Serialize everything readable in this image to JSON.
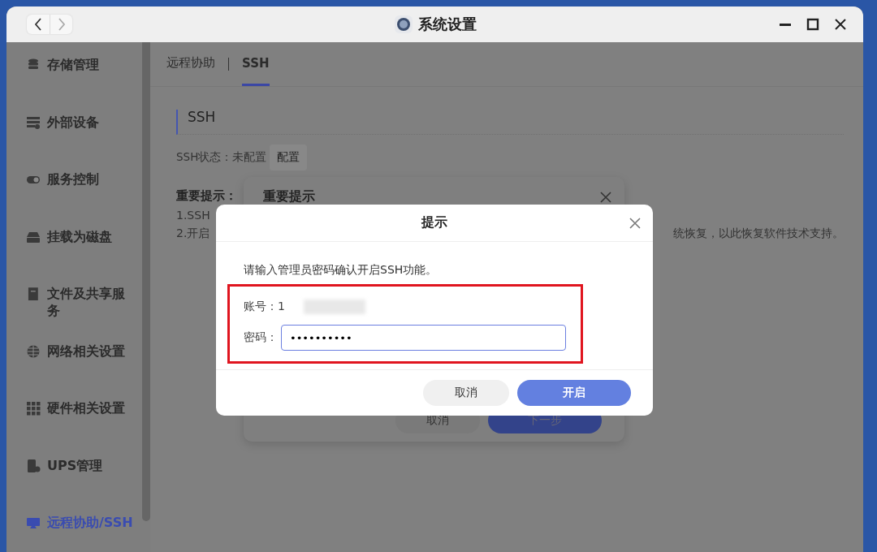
{
  "window": {
    "title": "系统设置"
  },
  "sidebar": {
    "items": [
      {
        "label": "存储管理",
        "selected": false
      },
      {
        "label": "外部设备",
        "selected": false
      },
      {
        "label": "服务控制",
        "selected": false
      },
      {
        "label": "挂载为磁盘",
        "selected": false
      },
      {
        "label": "文件及共享服务",
        "selected": false
      },
      {
        "label": "网络相关设置",
        "selected": false
      },
      {
        "label": "硬件相关设置",
        "selected": false
      },
      {
        "label": "UPS管理",
        "selected": false
      },
      {
        "label": "远程协助/SSH",
        "selected": true
      }
    ]
  },
  "tabs": [
    {
      "label": "远程协助",
      "selected": false
    },
    {
      "label": "SSH",
      "selected": true
    }
  ],
  "section": {
    "title": "SSH",
    "status_label": "SSH状态：",
    "status_value": "未配置",
    "configure_button": "配置"
  },
  "notice": {
    "title": "重要提示：",
    "lines": [
      "1.SSH",
      "2.开启"
    ],
    "line_tail": "统恢复，以此恢复软件技术支持。"
  },
  "back_dialog": {
    "title": "重要提示",
    "cancel": "取消",
    "next": "下一步"
  },
  "dialog": {
    "title": "提示",
    "message": "请输入管理员密码确认开启SSH功能。",
    "account_label": "账号：",
    "account_value": "1",
    "password_label": "密码：",
    "password_value": "••••••••••",
    "cancel": "取消",
    "confirm": "开启"
  }
}
